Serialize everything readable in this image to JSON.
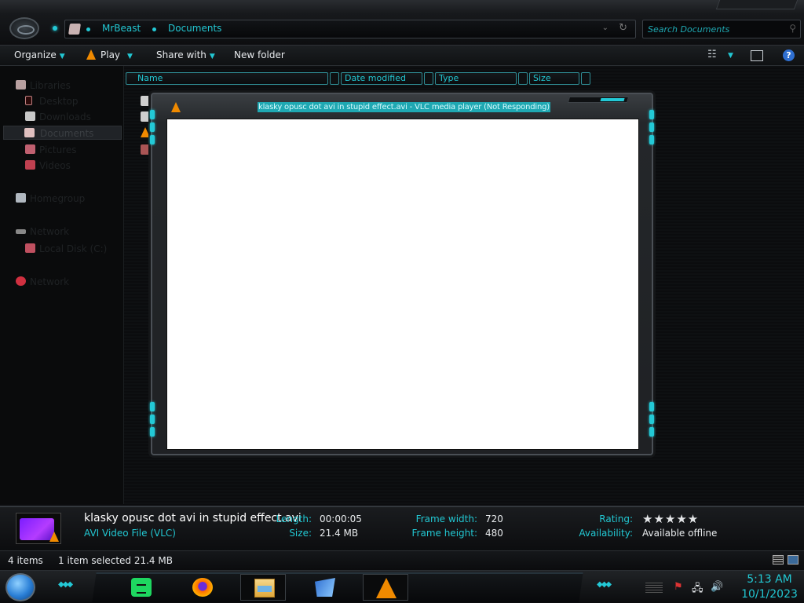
{
  "address": {
    "crumbs": [
      "MrBeast",
      "Documents"
    ]
  },
  "search": {
    "placeholder": "Search Documents"
  },
  "toolbar": {
    "organize": "Organize",
    "play": "Play",
    "share_with": "Share with",
    "new_folder": "New folder"
  },
  "navpane": {
    "items": [
      {
        "label": "Libraries"
      },
      {
        "label": "Desktop"
      },
      {
        "label": "Downloads"
      },
      {
        "label": "Documents"
      },
      {
        "label": "Pictures"
      },
      {
        "label": "Videos"
      },
      {
        "label": "Homegroup"
      },
      {
        "label": "Network"
      },
      {
        "label": "Local Disk (C:)"
      },
      {
        "label": "Network"
      }
    ]
  },
  "columns": {
    "name": "Name",
    "date_modified": "Date modified",
    "type": "Type",
    "size": "Size"
  },
  "vlc_window": {
    "title": "klasky opusc dot avi in stupid effect.avi - VLC media player (Not Responding)"
  },
  "details": {
    "filename": "klasky opusc dot avi in stupid effect.avi",
    "filetype": "AVI Video File (VLC)",
    "length_label": "Length:",
    "length_value": "00:00:05",
    "size_label": "Size:",
    "size_value": "21.4 MB",
    "frame_width_label": "Frame width:",
    "frame_width_value": "720",
    "frame_height_label": "Frame height:",
    "frame_height_value": "480",
    "rating_label": "Rating:",
    "rating_stars": "★★★★★",
    "availability_label": "Availability:",
    "availability_value": "Available offline"
  },
  "statusbar": {
    "item_count": "4 items",
    "selection": "1 item selected  21.4 MB"
  },
  "taskbar": {
    "time": "5:13 AM",
    "date": "10/1/2023",
    "apps": [
      "spotify-icon",
      "firefox-icon",
      "file-explorer-icon",
      "vegas-icon",
      "vlc-icon"
    ]
  },
  "colors": {
    "accent": "#22c7d2",
    "vlc_orange": "#f08a00",
    "background": "#0b0c0e"
  }
}
